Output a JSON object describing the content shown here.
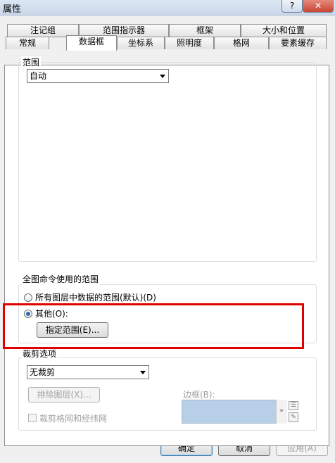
{
  "window": {
    "title": "属性",
    "help_label": "?",
    "close_label": "✕"
  },
  "tabs_row1": [
    "注记组",
    "范围指示器",
    "框架",
    "大小和位置"
  ],
  "tabs_row2": [
    "常规",
    "数据框",
    "坐标系",
    "照明度",
    "格网",
    "要素缓存"
  ],
  "active_tab": "数据框",
  "extent": {
    "group_label": "范围",
    "mode_value": "自动"
  },
  "full_extent": {
    "group_label": "全图命令使用的范围",
    "option_all": "所有图层中数据的范围(默认)(D)",
    "option_other": "其他(O):",
    "specify_button": "指定范围(E)..."
  },
  "clip": {
    "group_label": "裁剪选项",
    "mode_value": "无裁剪",
    "exclude_button": "排除图层(X)...",
    "border_label": "边框(B):",
    "clip_grids_label": "裁剪格网和经纬网"
  },
  "footer": {
    "ok": "确定",
    "cancel": "取消",
    "apply": "应用(A)"
  },
  "colors": {
    "highlight_box": "#e00000",
    "border_swatch": "#b8cfe8"
  }
}
